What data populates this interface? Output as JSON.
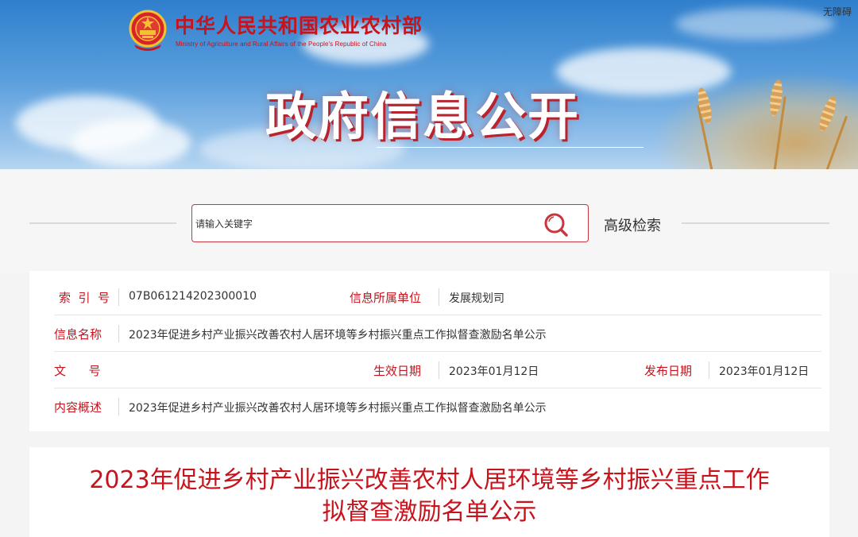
{
  "header": {
    "site_title": "中华人民共和国农业农村部",
    "site_subtitle": "Ministry of Agriculture and Rural Affairs of the People's Republic of China",
    "accessibility_label": "无障碍",
    "section_title": "政府信息公开",
    "emblem_icon": "national-emblem-icon"
  },
  "search": {
    "placeholder": "请输入关键字",
    "search_icon": "search-icon",
    "advanced_label": "高级检索"
  },
  "info": {
    "index_label": "索  引  号",
    "index_value": "07B061214202300010",
    "unit_label": "信息所属单位",
    "unit_value": "发展规划司",
    "name_label": "信息名称",
    "name_value": "2023年促进乡村产业振兴改善农村人居环境等乡村振兴重点工作拟督查激励名单公示",
    "docno_label": "文      号",
    "docno_value": "",
    "effective_label": "生效日期",
    "effective_value": "2023年01月12日",
    "publish_label": "发布日期",
    "publish_value": "2023年01月12日",
    "summary_label": "内容概述",
    "summary_value": "2023年促进乡村产业振兴改善农村人居环境等乡村振兴重点工作拟督查激励名单公示"
  },
  "article": {
    "title_line1": "2023年促进乡村产业振兴改善农村人居环境等乡村振兴重点工作",
    "title_line2": "拟督查激励名单公示"
  },
  "colors": {
    "brand_red": "#c6131c",
    "sky_blue": "#2f7fcd",
    "border_red": "#c9363f"
  }
}
